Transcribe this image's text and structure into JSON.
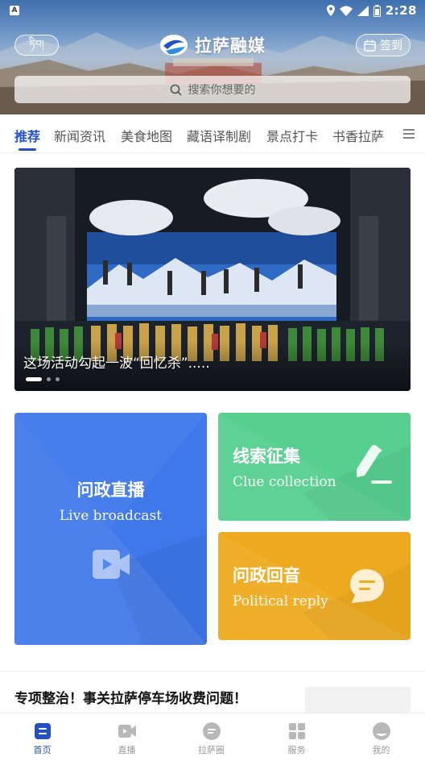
{
  "status_bar": {
    "time": "2:28"
  },
  "header": {
    "lang_toggle": "ཏིབ།",
    "brand_name": "拉萨融媒",
    "checkin_label": "签到",
    "search_placeholder": "搜索你想要的"
  },
  "tabs": [
    {
      "label": "推荐",
      "active": true
    },
    {
      "label": "新闻资讯",
      "active": false
    },
    {
      "label": "美食地图",
      "active": false
    },
    {
      "label": "藏语译制剧",
      "active": false
    },
    {
      "label": "景点打卡",
      "active": false
    },
    {
      "label": "书香拉萨",
      "active": false
    }
  ],
  "banner": {
    "caption": "这场活动勾起一波“回忆杀”.....",
    "slide_count": 3,
    "active_slide": 1
  },
  "cards": {
    "live": {
      "title": "问政直播",
      "subtitle": "Live broadcast",
      "color": "#3f78ea"
    },
    "clue": {
      "title": "线索征集",
      "subtitle": "Clue collection",
      "color": "#57cf8f"
    },
    "reply": {
      "title": "问政回音",
      "subtitle": "Political reply",
      "color": "#eeaa1e"
    }
  },
  "news": {
    "first_title": "专项整治！事关拉萨停车场收费问题！"
  },
  "bottom_nav": [
    {
      "label": "首页",
      "icon": "home-icon",
      "active": true
    },
    {
      "label": "直播",
      "icon": "video-icon",
      "active": false
    },
    {
      "label": "拉萨圈",
      "icon": "chat-bubble-icon",
      "active": false
    },
    {
      "label": "服务",
      "icon": "grid-icon",
      "active": false
    },
    {
      "label": "我的",
      "icon": "profile-icon",
      "active": false
    }
  ],
  "colors": {
    "accent": "#2350c8",
    "nav_inactive": "#999999"
  }
}
